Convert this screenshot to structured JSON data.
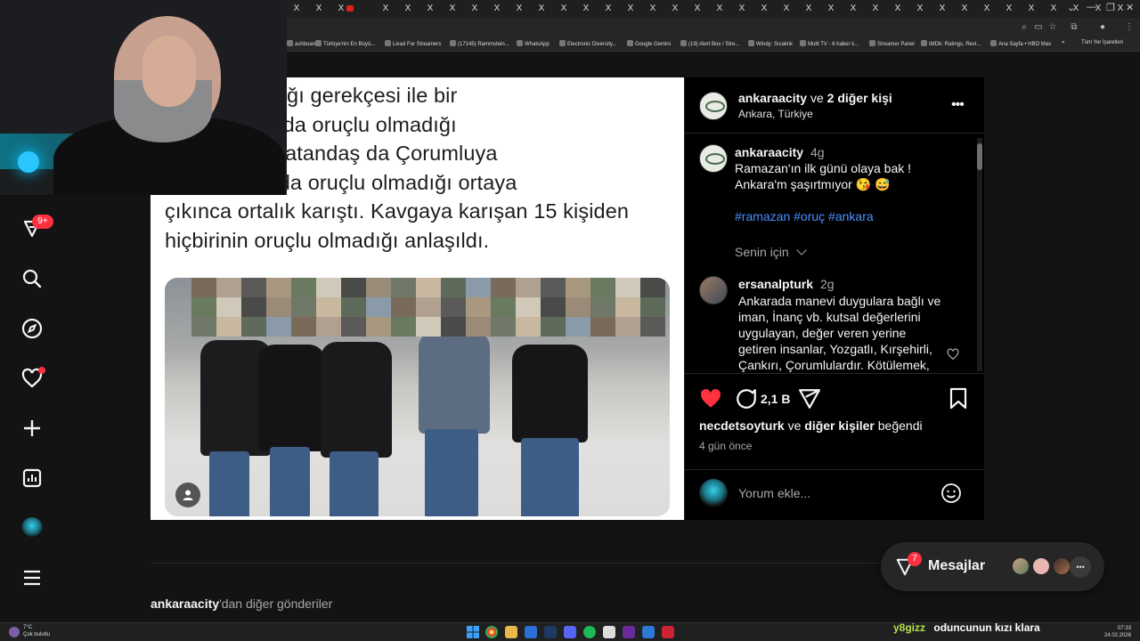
{
  "browser": {
    "tabs": [
      "X",
      "X",
      "X",
      "",
      "X",
      "X",
      "X",
      "X",
      "X",
      "X",
      "X",
      "X",
      "X",
      "X",
      "X",
      "X",
      "X",
      "X",
      "X",
      "X",
      "X",
      "X",
      "X",
      "X",
      "X",
      "X",
      "X",
      "X",
      "X",
      "X",
      "X",
      "X",
      "X",
      "X",
      "X",
      "X",
      "X",
      "X",
      "X",
      "X",
      "X"
    ],
    "new_tab": "+",
    "window_controls": [
      "⌄",
      "—",
      "❐",
      "✕"
    ],
    "bookmarks": [
      "ashboard",
      "Türkiye'nin En Büyü...",
      "Livad For Streamers",
      "(17145) Rammstein...",
      "WhatsApp",
      "Electronic Diversity...",
      "Google Gemini",
      "(19) Alert Box / Stre...",
      "Windy: Sıcaklık",
      "Multi TV - 6 haber k...",
      "Streamer Panel",
      "IMDb: Ratings, Revi...",
      "Ana Sayfa • HBO Max"
    ],
    "bookmarks_more": "»",
    "all_bookmarks": "Tüm Yer İşaretleri"
  },
  "nav": {
    "notifications_badge": "9+",
    "icons": [
      "threads-icon",
      "search-icon",
      "explore-icon",
      "heart-icon",
      "create-icon",
      "dashboard-icon",
      "profile-avatar",
      "menu-icon"
    ]
  },
  "post": {
    "news_lines": [
      "Oruç tutmadığı gerekçesi ile bir",
      "Çankırılı'nın da oruçlu olmadığı",
      "Yozgatlı bir vatandaş da Çorumluya",
      "Yozgatlı'nın da oruçlu olmadığı ortaya",
      "çıkınca ortalık karıştı. Kavgaya karışan 15 kişiden",
      "hiçbirinin oruçlu olmadığı anlaşıldı."
    ],
    "header": {
      "username": "ankaraacity",
      "collab_suffix": "ve",
      "collab_others": "2 diğer kişi",
      "location": "Ankara, Türkiye",
      "more": "•••"
    },
    "caption": {
      "username": "ankaraacity",
      "time": "4g",
      "line1": "Ramazan'ın ilk günü olaya bak !",
      "line2": "Ankara'm şaşırtmıyor",
      "emojis": "😘 😅",
      "hashtags": "#ramazan #oruç #ankara",
      "for_you": "Senin için"
    },
    "comment": {
      "username": "ersanalpturk",
      "time": "2g",
      "lines": [
        "Ankarada manevi duygulara bağlı ve",
        "iman, İnanç vb. kutsal değerlerini",
        "uygulayan, değer veren yerine",
        "getiren insanlar, Yozgatlı, Kırşehirli,",
        "Çankırı, Çorumlulardır. Kötülemek,"
      ]
    },
    "actions": {
      "comment_count": "2,1 B"
    },
    "likes": {
      "user": "necdetsoyturk",
      "connector": "ve",
      "others": "diğer kişiler",
      "suffix": "beğendi"
    },
    "ago": "4 gün önce",
    "comment_placeholder": "Yorum ekle..."
  },
  "more_posts": {
    "username": "ankaraacity",
    "suffix": "'dan diğer gönderiler"
  },
  "messages": {
    "label": "Mesajlar",
    "badge": "7",
    "more": "•••"
  },
  "taskbar": {
    "weather_temp": "7°C",
    "weather_desc": "Çok bulutlu",
    "chat_user": "y8gizz",
    "chat_message": "oduncunun kızı klara",
    "time": "07:33",
    "date": "24.02.2026"
  },
  "colors": {
    "like_red": "#ff3040",
    "hashtag_blue": "#4a8fff",
    "chat_user_green": "#b4e04a",
    "chat_text": "#ffffff"
  }
}
